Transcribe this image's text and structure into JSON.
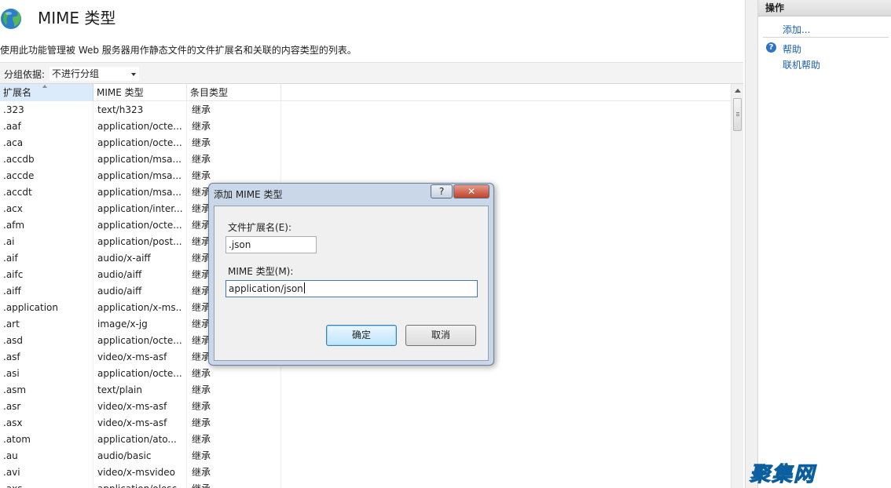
{
  "header": {
    "title": "MIME 类型",
    "description": "使用此功能管理被 Web 服务器用作静态文件的文件扩展名和关联的内容类型的列表。"
  },
  "group_bar": {
    "label": "分组依据:",
    "selected": "不进行分组"
  },
  "table": {
    "columns": [
      "扩展名",
      "MIME 类型",
      "条目类型"
    ],
    "rows": [
      [
        ".323",
        "text/h323",
        "继承"
      ],
      [
        ".aaf",
        "application/octe...",
        "继承"
      ],
      [
        ".aca",
        "application/octe...",
        "继承"
      ],
      [
        ".accdb",
        "application/msa...",
        "继承"
      ],
      [
        ".accde",
        "application/msa...",
        "继承"
      ],
      [
        ".accdt",
        "application/msa...",
        "继承"
      ],
      [
        ".acx",
        "application/inter...",
        "继承"
      ],
      [
        ".afm",
        "application/octe...",
        "继承"
      ],
      [
        ".ai",
        "application/post...",
        "继承"
      ],
      [
        ".aif",
        "audio/x-aiff",
        "继承"
      ],
      [
        ".aifc",
        "audio/aiff",
        "继承"
      ],
      [
        ".aiff",
        "audio/aiff",
        "继承"
      ],
      [
        ".application",
        "application/x-ms...",
        "继承"
      ],
      [
        ".art",
        "image/x-jg",
        "继承"
      ],
      [
        ".asd",
        "application/octe...",
        "继承"
      ],
      [
        ".asf",
        "video/x-ms-asf",
        "继承"
      ],
      [
        ".asi",
        "application/octe...",
        "继承"
      ],
      [
        ".asm",
        "text/plain",
        "继承"
      ],
      [
        ".asr",
        "video/x-ms-asf",
        "继承"
      ],
      [
        ".asx",
        "video/x-ms-asf",
        "继承"
      ],
      [
        ".atom",
        "application/ato...",
        "继承"
      ],
      [
        ".au",
        "audio/basic",
        "继承"
      ],
      [
        ".avi",
        "video/x-msvideo",
        "继承"
      ],
      [
        ".axs",
        "application/olesc...",
        "继承"
      ]
    ]
  },
  "actions": {
    "header": "操作",
    "add": "添加...",
    "help": "帮助",
    "online_help": "联机帮助"
  },
  "dialog": {
    "title": "添加 MIME 类型",
    "help_button": "?",
    "close_button": "✕",
    "ext_label": "文件扩展名(E):",
    "ext_value": ".json",
    "mime_label": "MIME 类型(M):",
    "mime_value": "application/json",
    "ok": "确定",
    "cancel": "取消"
  },
  "watermark": "聚集网",
  "colors": {
    "link": "#1a5fad",
    "selected_header": "#dcebfb",
    "dialog_frame": "#c9d7e8",
    "watermark": "#1d8fd6"
  }
}
